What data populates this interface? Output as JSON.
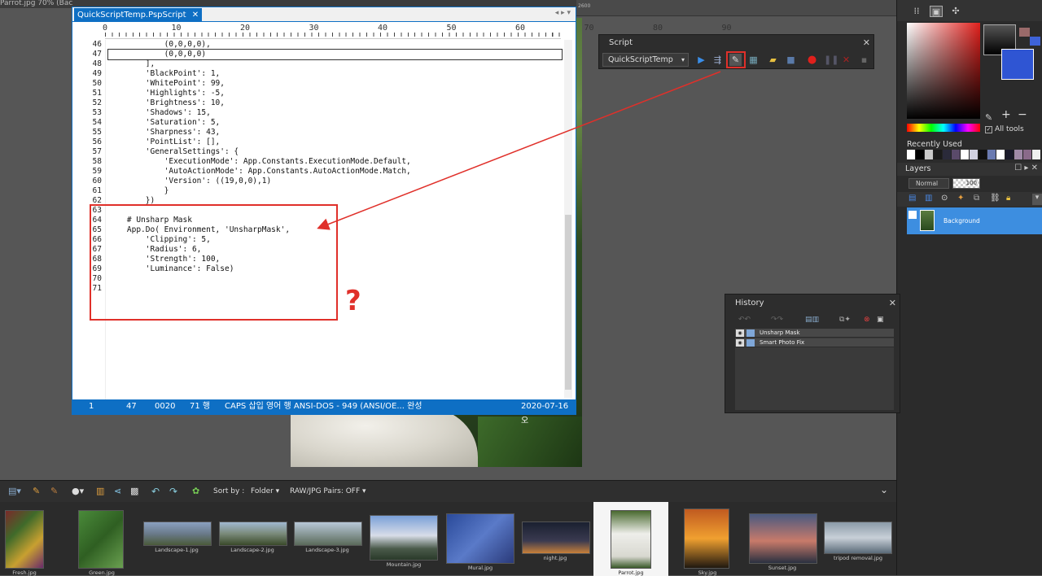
{
  "top": {
    "tab_tail": "Parrot.jpg   70% (Bac",
    "ruler_num": "2600"
  },
  "editor": {
    "tab_label": "QuickScriptTemp.PspScript",
    "tab_close": "✕",
    "tab_nav": "◂ ▸ ▾",
    "ruler": [
      "0",
      "10",
      "20",
      "30",
      "40",
      "50",
      "60",
      "70",
      "80",
      "90"
    ],
    "lines": [
      {
        "n": "46",
        "code": "            (0,0,0,0),"
      },
      {
        "n": "47",
        "code": "            (0,0,0,0)",
        "current": true
      },
      {
        "n": "48",
        "code": "        ],"
      },
      {
        "n": "49",
        "code": "        'BlackPoint': 1,"
      },
      {
        "n": "50",
        "code": "        'WhitePoint': 99,"
      },
      {
        "n": "51",
        "code": "        'Highlights': -5,"
      },
      {
        "n": "52",
        "code": "        'Brightness': 10,"
      },
      {
        "n": "53",
        "code": "        'Shadows': 15,"
      },
      {
        "n": "54",
        "code": "        'Saturation': 5,"
      },
      {
        "n": "55",
        "code": "        'Sharpness': 43,"
      },
      {
        "n": "56",
        "code": "        'PointList': [],"
      },
      {
        "n": "57",
        "code": "        'GeneralSettings': {"
      },
      {
        "n": "58",
        "code": "            'ExecutionMode': App.Constants.ExecutionMode.Default,"
      },
      {
        "n": "59",
        "code": "            'AutoActionMode': App.Constants.AutoActionMode.Match,"
      },
      {
        "n": "60",
        "code": "            'Version': ((19,0,0),1)"
      },
      {
        "n": "61",
        "code": "            }"
      },
      {
        "n": "62",
        "code": "        })"
      },
      {
        "n": "63",
        "code": ""
      },
      {
        "n": "64",
        "code": "    # Unsharp Mask"
      },
      {
        "n": "65",
        "code": "    App.Do( Environment, 'UnsharpMask',"
      },
      {
        "n": "66",
        "code": "        'Clipping': 5,"
      },
      {
        "n": "67",
        "code": "        'Radius': 6,"
      },
      {
        "n": "68",
        "code": "        'Strength': 100,"
      },
      {
        "n": "69",
        "code": "        'Luminance': False)"
      },
      {
        "n": "70",
        "code": ""
      },
      {
        "n": "71",
        "code": ""
      }
    ],
    "status": {
      "col1": "1",
      "col2": "47",
      "col3": "0020",
      "col4": "71 행",
      "col5": "CAPS  삽입  영어  행  ANSI-DOS - 949   (ANSI/OE...  완성",
      "date": "2020-07-16 오"
    }
  },
  "annotation": {
    "qmark": "?"
  },
  "script_palette": {
    "title": "Script",
    "close": "✕",
    "selected_script": "QuickScriptTemp",
    "caret": "▾"
  },
  "right_panel": {
    "all_tools": "All tools",
    "check": "✓",
    "recently_used": "Recently Used",
    "recent_colors": [
      "#ffffff",
      "#000000",
      "#c8c8c8",
      "#1a1a1a",
      "#2a2a3a",
      "#5a4a6a",
      "#ffffff",
      "#d0d0e0",
      "#101010",
      "#6a7ab0",
      "#ffffff",
      "#1a1a2a",
      "#a08aa8",
      "#8a6a8a",
      "#f0f0f0"
    ],
    "layers_title": "Layers",
    "layers_controls": "☐ ▸ ✕",
    "blend_mode": "Normal",
    "opacity": "100",
    "layer_name": "Background"
  },
  "history": {
    "title": "History",
    "close": "✕",
    "items": [
      "Unsharp Mask",
      "Smart Photo Fix"
    ]
  },
  "organizer": {
    "sort_label": "Sort by :",
    "sort_value": "Folder ▾",
    "pairs_label": "RAW/JPG Pairs: OFF ▾",
    "collapse": "⌄",
    "thumbs": [
      {
        "name": "Fresh.jpg",
        "color": "linear-gradient(135deg,#7a2a2a,#3f6a2a,#c8a030,#6a2a6a)"
      },
      {
        "name": "Green.jpg",
        "color": "linear-gradient(135deg,#4a8a3a,#2f5f22,#6aa050)"
      },
      {
        "name": "Landscape-1.jpg",
        "color": "linear-gradient(#8aa0c0,#6a7a8a 50%,#4a5a3a)"
      },
      {
        "name": "Landscape-2.jpg",
        "color": "linear-gradient(#a0b8d0,#7a8a7a 50%,#3a4a2a)"
      },
      {
        "name": "Landscape-3.jpg",
        "color": "linear-gradient(#b8c8d8,#8a9a9a 50%,#5a6a5a)"
      },
      {
        "name": "Mountain.jpg",
        "color": "linear-gradient(#7aa0d8,#d8dde8 45%,#4a5a4a 75%,#2a3a2a)"
      },
      {
        "name": "Mural.jpg",
        "color": "linear-gradient(135deg,#2a4a9a,#5a7ac8,#2a3a7a)"
      },
      {
        "name": "night.jpg",
        "color": "linear-gradient(#1a2030,#3a3a50 60%,#c8803a)"
      },
      {
        "name": "Parrot.jpg",
        "color": "linear-gradient(#4a6a30,#eeeeea 40%,#d8d8d0 80%,#3a5a2a)"
      },
      {
        "name": "Sky.jpg",
        "color": "linear-gradient(#c05a20,#f0a030 50%,#201810)"
      },
      {
        "name": "Sunset.jpg",
        "color": "linear-gradient(#4a5a80,#c87a6a 55%,#2a3040)"
      },
      {
        "name": "tripod removal.jpg",
        "color": "linear-gradient(#8a9aa8,#c8d0d8 50%,#5a6a78)"
      }
    ]
  }
}
